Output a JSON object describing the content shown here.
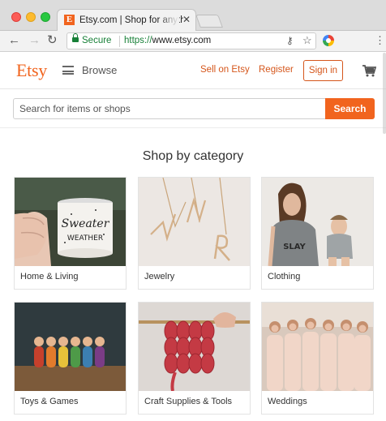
{
  "browser": {
    "tab_title": "Etsy.com | Shop for anything fr",
    "favicon_letter": "E",
    "secure_label": "Secure",
    "url_protocol": "https://",
    "url_host": "www.etsy.com"
  },
  "header": {
    "logo": "Etsy",
    "browse_label": "Browse",
    "sell_label": "Sell on Etsy",
    "register_label": "Register",
    "signin_label": "Sign in"
  },
  "search": {
    "placeholder": "Search for items or shops",
    "button_label": "Search"
  },
  "section_title": "Shop by category",
  "categories": [
    {
      "label": "Home & Living",
      "mug_line1": "Sweater",
      "mug_line2": "WEATHER"
    },
    {
      "label": "Jewelry"
    },
    {
      "label": "Clothing"
    },
    {
      "label": "Toys & Games"
    },
    {
      "label": "Craft Supplies & Tools"
    },
    {
      "label": "Weddings"
    }
  ],
  "colors": {
    "brand": "#f1641e",
    "link": "#d5561b"
  }
}
